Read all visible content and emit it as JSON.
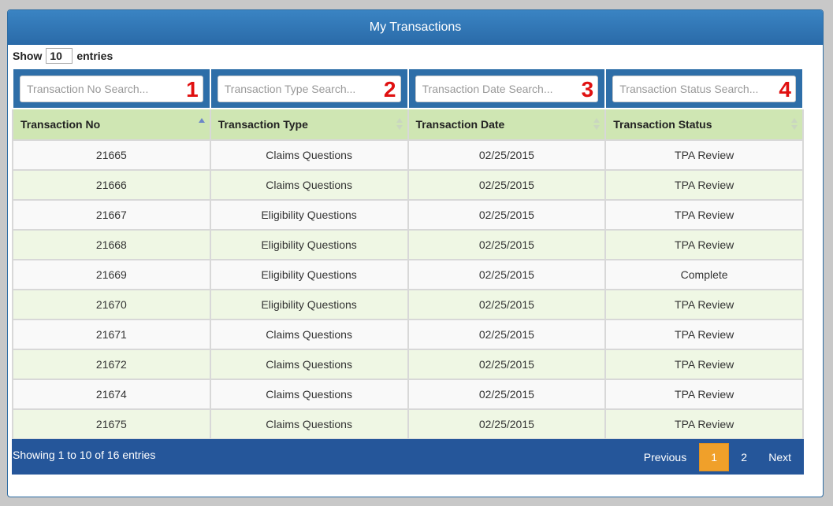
{
  "panel": {
    "title": "My Transactions"
  },
  "length_control": {
    "show_label": "Show",
    "value": "10",
    "entries_label": "entries"
  },
  "search_fields": [
    {
      "placeholder": "Transaction No Search...",
      "marker": "1"
    },
    {
      "placeholder": "Transaction Type Search...",
      "marker": "2"
    },
    {
      "placeholder": "Transaction Date Search...",
      "marker": "3"
    },
    {
      "placeholder": "Transaction Status Search...",
      "marker": "4"
    }
  ],
  "columns": [
    {
      "label": "Transaction No",
      "sort": "asc"
    },
    {
      "label": "Transaction Type",
      "sort": "none"
    },
    {
      "label": "Transaction Date",
      "sort": "none"
    },
    {
      "label": "Transaction Status",
      "sort": "none"
    }
  ],
  "rows": [
    [
      "21665",
      "Claims Questions",
      "02/25/2015",
      "TPA Review"
    ],
    [
      "21666",
      "Claims Questions",
      "02/25/2015",
      "TPA Review"
    ],
    [
      "21667",
      "Eligibility Questions",
      "02/25/2015",
      "TPA Review"
    ],
    [
      "21668",
      "Eligibility Questions",
      "02/25/2015",
      "TPA Review"
    ],
    [
      "21669",
      "Eligibility Questions",
      "02/25/2015",
      "Complete"
    ],
    [
      "21670",
      "Eligibility Questions",
      "02/25/2015",
      "TPA Review"
    ],
    [
      "21671",
      "Claims Questions",
      "02/25/2015",
      "TPA Review"
    ],
    [
      "21672",
      "Claims Questions",
      "02/25/2015",
      "TPA Review"
    ],
    [
      "21674",
      "Claims Questions",
      "02/25/2015",
      "TPA Review"
    ],
    [
      "21675",
      "Claims Questions",
      "02/25/2015",
      "TPA Review"
    ]
  ],
  "footer": {
    "info": "Showing 1 to 10 of 16 entries",
    "previous_label": "Previous",
    "pages": [
      "1",
      "2"
    ],
    "current_page": "1",
    "next_label": "Next"
  },
  "colors": {
    "header_blue": "#2e6ea8",
    "column_header_green": "#cfe6b3",
    "row_alt_green": "#eff7e4",
    "footer_blue": "#25569a",
    "active_page_orange": "#f0a02a",
    "marker_red": "#e01010"
  }
}
